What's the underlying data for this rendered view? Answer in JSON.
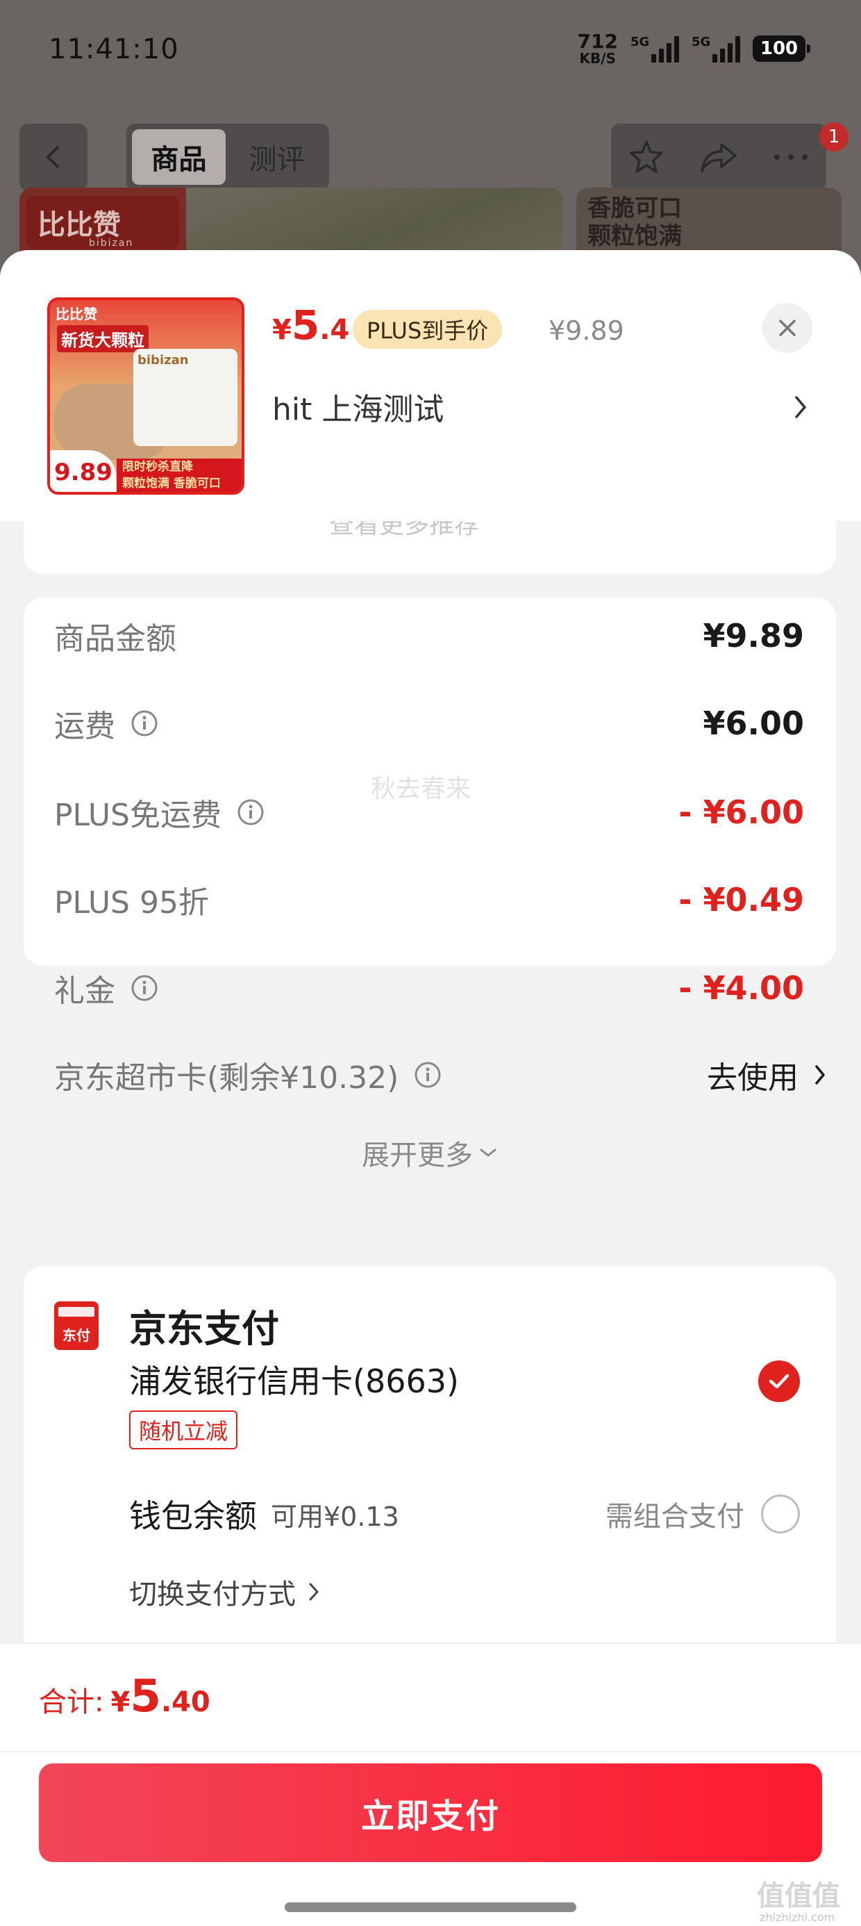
{
  "status_bar": {
    "time": "11:41:10",
    "net_speed_value": "712",
    "net_speed_unit": "KB/S",
    "signal_1_label": "5G",
    "signal_2_label": "5G",
    "battery": "100"
  },
  "nav": {
    "tabs": [
      {
        "label": "商品",
        "active": true
      },
      {
        "label": "测评",
        "active": false
      }
    ],
    "badge_count": "1"
  },
  "background": {
    "brand_logo": "比比赞",
    "brand_logo_sub": "bibizan",
    "right_banner_line1": "香脆可口",
    "right_banner_line2": "颗粒饱满"
  },
  "product": {
    "thumb_brand": "比比赞",
    "thumb_tag": "新货大颗粒",
    "thumb_pack_text": "bibizan",
    "thumb_price": "9.89",
    "thumb_strip_line1": "限时秒杀直降",
    "thumb_strip_line2": "颗粒饱满 香脆可口",
    "price_symbol": "¥",
    "price_int": "5",
    "price_dec": ".4",
    "plus_tag": "PLUS到手价",
    "original_price": "¥9.89",
    "address": "hit  上海测试"
  },
  "top_card_ghost": "查看更多推荐",
  "fees": {
    "rows": [
      {
        "label": "商品金额",
        "value": "¥9.89",
        "info": false
      },
      {
        "label": "运费",
        "value": "¥6.00",
        "info": true
      },
      {
        "label": "PLUS免运费",
        "value": "- ¥6.00",
        "info": true
      },
      {
        "label": "PLUS 95折",
        "value": "- ¥0.49",
        "info": false
      },
      {
        "label": "礼金",
        "value": "- ¥4.00",
        "info": true
      },
      {
        "label": "京东超市卡(剩余¥10.32)",
        "value": "去使用",
        "info": true
      }
    ],
    "watermark": "秋去春来",
    "expand_label": "展开更多"
  },
  "payment": {
    "logo_text": "东付",
    "title": "京东支付",
    "card_name": "浦发银行信用卡(8663)",
    "promo_tag": "随机立减",
    "wallet_label": "钱包余额",
    "wallet_available": "可用¥0.13",
    "wallet_note": "需组合支付",
    "switch_label": "切换支付方式"
  },
  "footer": {
    "total_label": "合计:",
    "total_symbol": "¥",
    "total_int": "5",
    "total_dec": ".40",
    "pay_button": "立即支付",
    "site_watermark": "值值值",
    "site_watermark_url": "zhizhizhi.com"
  },
  "colors": {
    "accent_red": "#e0221e",
    "plus_gold_bg": "#fbe4b4",
    "button_gradient_start": "#f24658",
    "button_gradient_end": "#ff1a2e"
  },
  "icons": [
    "back-arrow-icon",
    "star-icon",
    "share-icon",
    "more-icon",
    "close-icon",
    "chevron-right-icon",
    "info-icon",
    "chevron-down-icon",
    "check-icon"
  ]
}
